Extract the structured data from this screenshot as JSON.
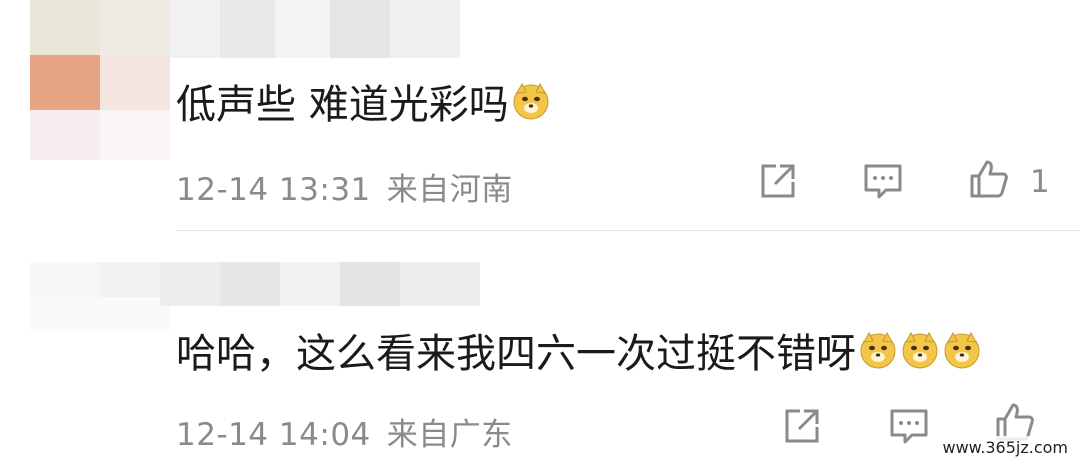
{
  "comments": [
    {
      "text": "低声些 难道光彩吗",
      "emoji": "doge-emoji",
      "time": "12-14 13:31",
      "location": "来自河南",
      "like_count": "1"
    },
    {
      "text": "哈哈，这么看来我四六一次过挺不错呀",
      "emoji": "doge-emoji",
      "time": "12-14 14:04",
      "location": "来自广东",
      "like_count": ""
    }
  ],
  "icons": {
    "share": "share-icon",
    "reply": "comment-icon",
    "like": "thumbs-up-icon"
  },
  "colors": {
    "text": "#1a1a1a",
    "meta": "#8a8a8a",
    "emoji_face": "#f3c64a"
  },
  "watermark": "www.365jz.com"
}
